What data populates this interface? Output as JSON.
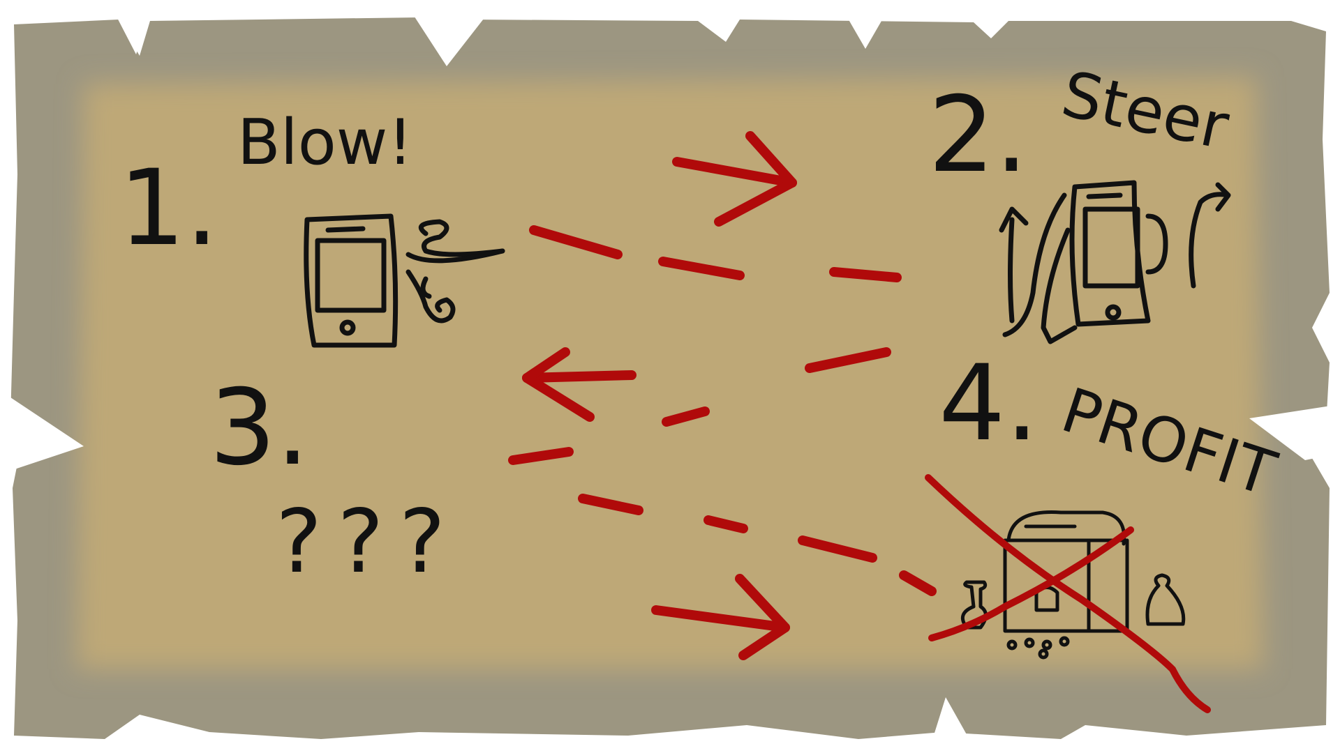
{
  "map": {
    "background": "#bfa878",
    "edge_shadow": "#9b9580",
    "ink": "#111111",
    "red_ink": "#b00a0a"
  },
  "steps": [
    {
      "number": "1.",
      "label": "Blow!",
      "icon": "phone-blow-icon"
    },
    {
      "number": "2.",
      "label": "Steer",
      "icon": "phone-steer-icon"
    },
    {
      "number": "3.",
      "label": "???",
      "icon": ""
    },
    {
      "number": "4.",
      "label": "PROFIT",
      "icon": "treasure-chest-icon"
    }
  ],
  "annotations": {
    "profit_crossed_out": true
  }
}
